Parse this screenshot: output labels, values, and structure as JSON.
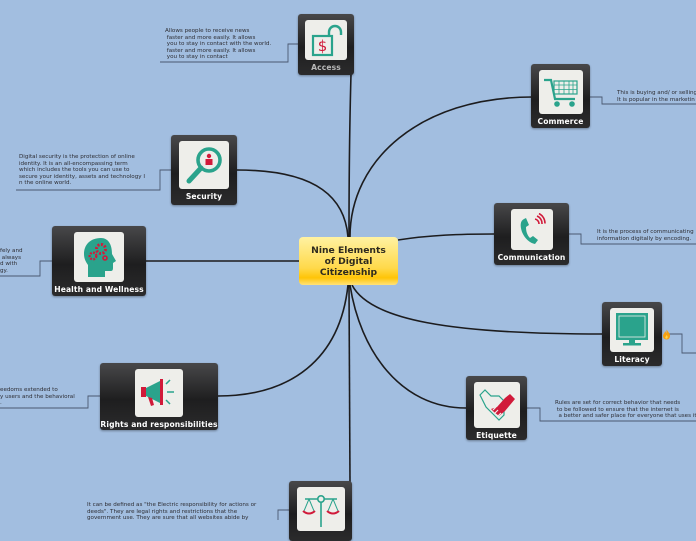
{
  "map": {
    "title": "Nine Elements\nof Digital\nCitizenship",
    "center_color": "#ffd23a",
    "background_color": "#a2bee0",
    "topics": [
      {
        "id": "access",
        "label": "Access",
        "icon": "open-padlock-dollar-icon",
        "note": "Allows people to receive news\n faster and more easily. It allows\n you to stay in contact with the world.\n faster and more easily. It allows\n you to stay in contact"
      },
      {
        "id": "commerce",
        "label": "Commerce",
        "icon": "shopping-cart-icon",
        "note": "This is buying and/ or selling\nIt is popular in the marketin"
      },
      {
        "id": "security",
        "label": "Security",
        "icon": "magnifier-person-icon",
        "note": "Digital security is the protection of online\nidentity. It is an all-encompassing term\nwhich includes the tools you can use to\nsecure your identity, assets and technology I\nn the online world."
      },
      {
        "id": "communication",
        "label": "Communication",
        "icon": "ringing-phone-icon",
        "note": "It is the process of communicating\ninformation digitally by encoding."
      },
      {
        "id": "health",
        "label": "Health and Wellness",
        "icon": "head-gears-icon",
        "note": "fely and\n always\nd with\ngy."
      },
      {
        "id": "literacy",
        "label": "Literacy",
        "icon": "computer-monitor-icon",
        "marker": "flame-icon"
      },
      {
        "id": "rights",
        "label": "Rights and responsibilities",
        "icon": "megaphone-icon",
        "note": "eedoms extended to\ny users and the behavioral\n."
      },
      {
        "id": "etiquette",
        "label": "Etiquette",
        "icon": "handshake-icon",
        "note": "Rules are set for correct behavior that needs\n to be followed to ensure that the internet is\n  a better and safer place for everyone that uses it."
      },
      {
        "id": "law",
        "label": "",
        "icon": "scales-of-justice-icon",
        "note": "It can be defined as \"the Electric responsibility for actions or\ndeeds\". They are legal rights and restrictions that the\ngovernment use. They are sure that all websites abide by"
      }
    ]
  }
}
